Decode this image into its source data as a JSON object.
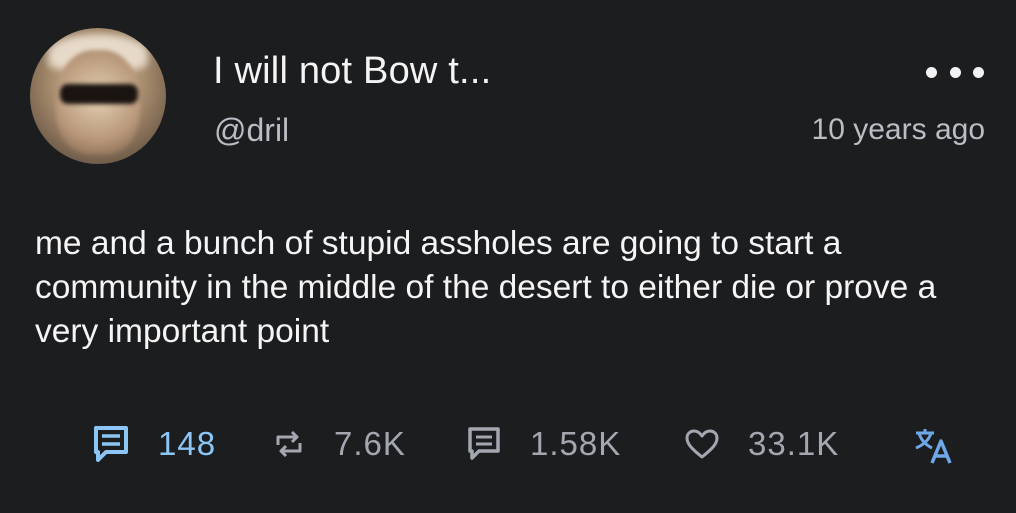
{
  "tweet": {
    "display_name": "I will not Bow t...",
    "handle": "@dril",
    "timestamp": "10 years ago",
    "text": "me and a bunch of stupid assholes are going to start a community in the middle of the desert to either die or prove a very important point"
  },
  "stats": {
    "comments": "148",
    "retweets": "7.6K",
    "quotes": "1.58K",
    "likes": "33.1K"
  },
  "icons": {
    "comments": "comment-icon",
    "retweets": "retweet-icon",
    "quotes": "quote-icon",
    "likes": "heart-icon",
    "translate": "translate-icon",
    "more": "more-dots-icon"
  },
  "colors": {
    "background": "#1c1d1f",
    "accent": "#8cc6f6",
    "muted": "#a3a8b0",
    "text": "#f5f5f5"
  }
}
